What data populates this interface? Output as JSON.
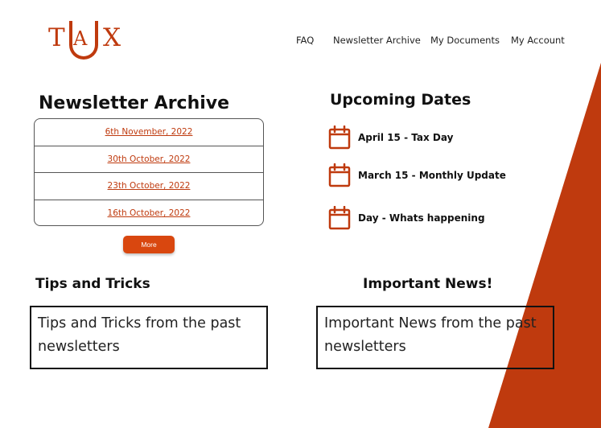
{
  "brand": {
    "logo_text": "TAUX",
    "accent_color": "#bf3a0e",
    "button_color": "#d9470f"
  },
  "nav": {
    "items": [
      "FAQ",
      "Newsletter Archive",
      "My Documents",
      "My Account"
    ]
  },
  "archive": {
    "title": "Newsletter Archive",
    "entries": [
      "6th November, 2022",
      "30th October, 2022",
      "23th October, 2022",
      "16th October, 2022"
    ],
    "more_label": "More"
  },
  "upcoming": {
    "title": "Upcoming Dates",
    "items": [
      {
        "label": "April 15 - Tax Day",
        "icon": "calendar-icon"
      },
      {
        "label": "March 15 - Monthly Update",
        "icon": "calendar-icon"
      },
      {
        "label": "Day - Whats happening",
        "icon": "calendar-icon"
      }
    ]
  },
  "tips": {
    "title": "Tips and Tricks",
    "body": "Tips and Tricks from the past newsletters"
  },
  "news": {
    "title": "Important News!",
    "body": "Important News from the past newsletters"
  }
}
